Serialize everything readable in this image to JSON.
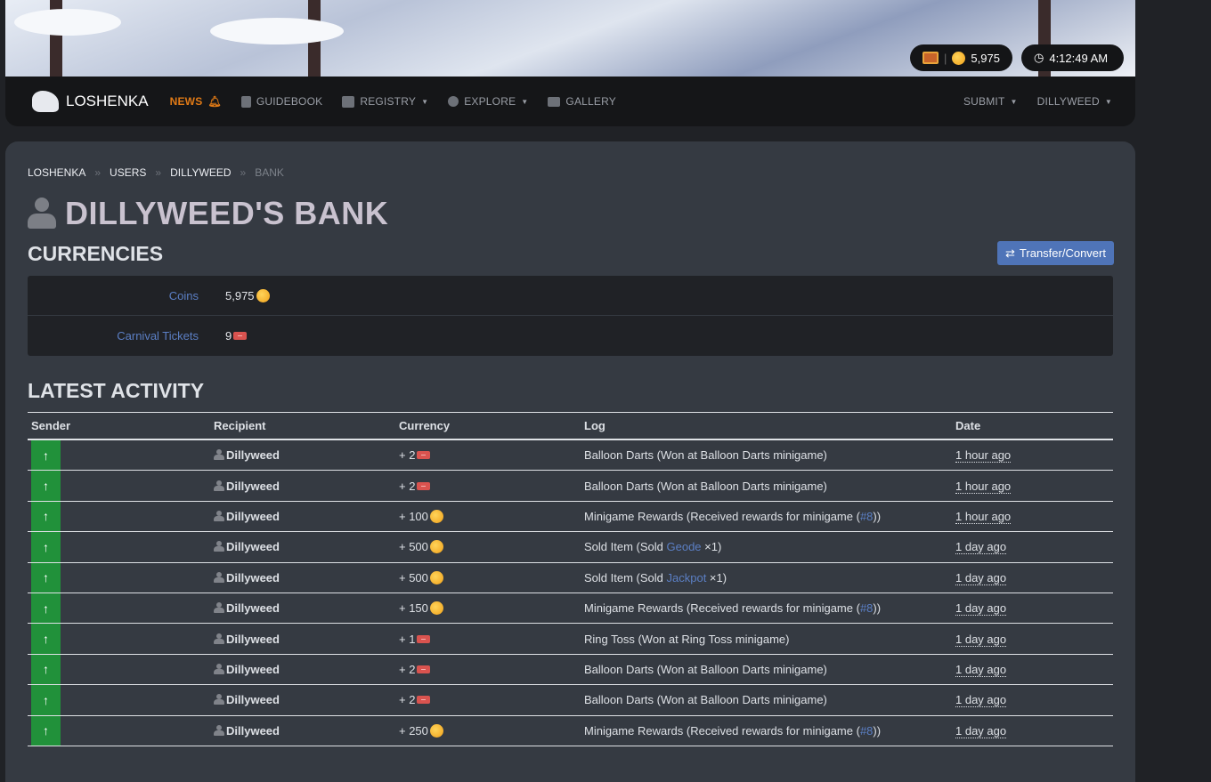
{
  "header": {
    "coin_balance": "5,975",
    "clock": "4:12:49 AM"
  },
  "nav": {
    "brand": "LOSHENKA",
    "items": [
      {
        "label": "NEWS"
      },
      {
        "label": "GUIDEBOOK"
      },
      {
        "label": "REGISTRY"
      },
      {
        "label": "EXPLORE"
      },
      {
        "label": "GALLERY"
      }
    ],
    "submit": "SUBMIT",
    "user": "DILLYWEED"
  },
  "breadcrumb": [
    "LOSHENKA",
    "USERS",
    "DILLYWEED",
    "BANK"
  ],
  "title": "DILLYWEED'S BANK",
  "currencies": {
    "heading": "CURRENCIES",
    "button": "Transfer/Convert",
    "rows": [
      {
        "label": "Coins",
        "value": "5,975",
        "icon": "coin"
      },
      {
        "label": "Carnival Tickets",
        "value": "9",
        "icon": "ticket"
      }
    ]
  },
  "activity": {
    "heading": "LATEST ACTIVITY",
    "columns": [
      "Sender",
      "Recipient",
      "Currency",
      "Log",
      "Date"
    ],
    "rows": [
      {
        "recipient": "Dillyweed",
        "amount": "+ 2",
        "icon": "ticket",
        "log_pre": "Balloon Darts (Won at Balloon Darts minigame)",
        "link": "",
        "log_post": "",
        "date": "1 hour ago"
      },
      {
        "recipient": "Dillyweed",
        "amount": "+ 2",
        "icon": "ticket",
        "log_pre": "Balloon Darts (Won at Balloon Darts minigame)",
        "link": "",
        "log_post": "",
        "date": "1 hour ago"
      },
      {
        "recipient": "Dillyweed",
        "amount": "+ 100",
        "icon": "coin",
        "log_pre": "Minigame Rewards (Received rewards for minigame (",
        "link": "#8",
        "log_post": "))",
        "date": "1 hour ago"
      },
      {
        "recipient": "Dillyweed",
        "amount": "+ 500",
        "icon": "coin",
        "log_pre": "Sold Item (Sold ",
        "link": "Geode",
        "log_post": " ×1)",
        "date": "1 day ago"
      },
      {
        "recipient": "Dillyweed",
        "amount": "+ 500",
        "icon": "coin",
        "log_pre": "Sold Item (Sold ",
        "link": "Jackpot",
        "log_post": " ×1)",
        "date": "1 day ago"
      },
      {
        "recipient": "Dillyweed",
        "amount": "+ 150",
        "icon": "coin",
        "log_pre": "Minigame Rewards (Received rewards for minigame (",
        "link": "#8",
        "log_post": "))",
        "date": "1 day ago"
      },
      {
        "recipient": "Dillyweed",
        "amount": "+ 1",
        "icon": "ticket",
        "log_pre": "Ring Toss (Won at Ring Toss minigame)",
        "link": "",
        "log_post": "",
        "date": "1 day ago"
      },
      {
        "recipient": "Dillyweed",
        "amount": "+ 2",
        "icon": "ticket",
        "log_pre": "Balloon Darts (Won at Balloon Darts minigame)",
        "link": "",
        "log_post": "",
        "date": "1 day ago"
      },
      {
        "recipient": "Dillyweed",
        "amount": "+ 2",
        "icon": "ticket",
        "log_pre": "Balloon Darts (Won at Balloon Darts minigame)",
        "link": "",
        "log_post": "",
        "date": "1 day ago"
      },
      {
        "recipient": "Dillyweed",
        "amount": "+ 250",
        "icon": "coin",
        "log_pre": "Minigame Rewards (Received rewards for minigame (",
        "link": "#8",
        "log_post": "))",
        "date": "1 day ago"
      }
    ]
  }
}
